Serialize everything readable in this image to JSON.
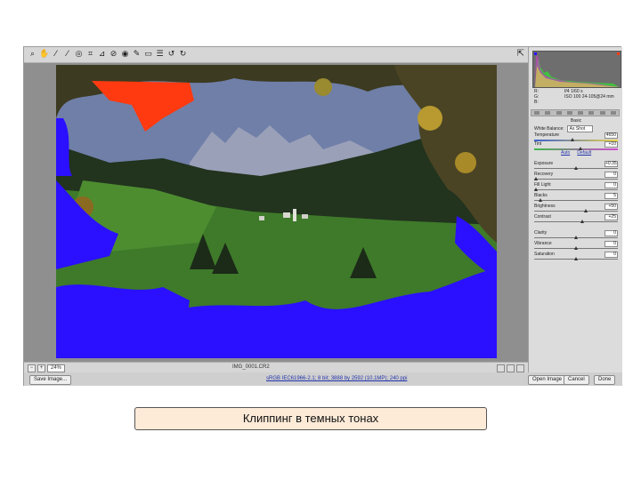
{
  "toolbar": {
    "tools": [
      {
        "icon": "zoom-icon",
        "glyph": "⌕"
      },
      {
        "icon": "hand-icon",
        "glyph": "✋"
      },
      {
        "icon": "white-balance-icon",
        "glyph": "⁄"
      },
      {
        "icon": "color-sampler-icon",
        "glyph": "⁄"
      },
      {
        "icon": "targeted-adjust-icon",
        "glyph": "◎"
      },
      {
        "icon": "crop-icon",
        "glyph": "⌗"
      },
      {
        "icon": "straighten-icon",
        "glyph": "⊿"
      },
      {
        "icon": "spot-removal-icon",
        "glyph": "⊘"
      },
      {
        "icon": "red-eye-icon",
        "glyph": "◉"
      },
      {
        "icon": "adjustment-brush-icon",
        "glyph": "✎"
      },
      {
        "icon": "graduated-filter-icon",
        "glyph": "▭"
      },
      {
        "icon": "preferences-icon",
        "glyph": "☰"
      },
      {
        "icon": "rotate-ccw-icon",
        "glyph": "↺"
      },
      {
        "icon": "rotate-cw-icon",
        "glyph": "↻"
      }
    ],
    "fullscreen_glyph": "⇱"
  },
  "status_bar": {
    "zoom_minus": "−",
    "zoom_plus": "+",
    "zoom_value": "24%",
    "filename": "IMG_0001.CR2"
  },
  "bottom_bar": {
    "save_image": "Save Image...",
    "workflow_link": "sRGB IEC61966-2.1; 8 bit; 3888 by 2592 (10.1MP); 240 ppi",
    "open_image": "Open Image",
    "cancel": "Cancel",
    "done": "Done"
  },
  "panel": {
    "readout_rgb": [
      "R:",
      "G:",
      "B:"
    ],
    "readout_values": [
      "f/4  1/60 s",
      "ISO 100  24-105@24 mm"
    ],
    "section_title": "Basic",
    "white_balance_label": "White Balance:",
    "white_balance_value": "As Shot",
    "auto_link": "Auto",
    "default_link": "Default",
    "sliders": [
      {
        "label": "Temperature",
        "value": "4650",
        "track": "wb-temp",
        "position": 0.45
      },
      {
        "label": "Tint",
        "value": "+10",
        "track": "wb-tint",
        "position": 0.55
      },
      {
        "label": "Exposure",
        "value": "+0.35",
        "track": "",
        "position": 0.5
      },
      {
        "label": "Recovery",
        "value": "0",
        "track": "",
        "position": 0.0
      },
      {
        "label": "Fill Light",
        "value": "0",
        "track": "",
        "position": 0.0
      },
      {
        "label": "Blacks",
        "value": "5",
        "track": "",
        "position": 0.05
      },
      {
        "label": "Brightness",
        "value": "+50",
        "track": "",
        "position": 0.62
      },
      {
        "label": "Contrast",
        "value": "+25",
        "track": "",
        "position": 0.58
      },
      {
        "label": "Clarity",
        "value": "0",
        "track": "",
        "position": 0.5
      },
      {
        "label": "Vibrance",
        "value": "0",
        "track": "",
        "position": 0.5
      },
      {
        "label": "Saturation",
        "value": "0",
        "track": "",
        "position": 0.5
      }
    ]
  },
  "caption": {
    "text": "Клиппинг в темных тонах"
  },
  "colors": {
    "shadow_clipping": "#2a10ff",
    "highlight_clipping": "#ff3a10",
    "sky": "#6f7fa8",
    "mountains": "#9aa0b8",
    "meadow": "#3e7a2a",
    "forest": "#22331e"
  }
}
